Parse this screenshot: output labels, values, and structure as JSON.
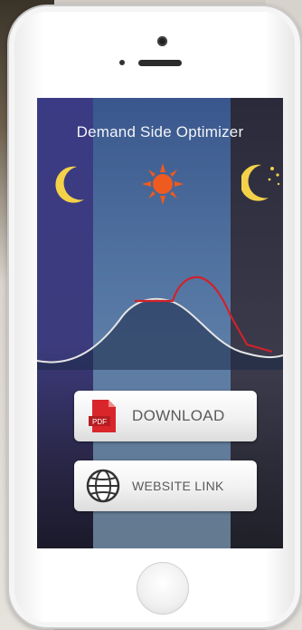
{
  "app": {
    "title": "Demand Side Optimizer"
  },
  "icons": {
    "left": "crescent-moon",
    "center": "sun",
    "right": "crescent-moon-with-stars"
  },
  "chart": {
    "demand_curve_color": "#e6e6e6",
    "optimized_curve_color": "#d0222b"
  },
  "buttons": {
    "download": {
      "label": "DOWNLOAD",
      "icon": "pdf-icon"
    },
    "website": {
      "label": "WEBSITE LINK",
      "icon": "globe-icon"
    }
  },
  "colors": {
    "moon": "#f3d24a",
    "sun": "#ef5a1f",
    "pdf": "#d9262b",
    "button_text": "#5a5a5a"
  }
}
